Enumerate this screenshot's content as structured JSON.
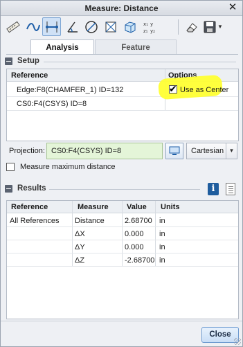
{
  "window": {
    "title": "Measure: Distance",
    "close_icon": "close-icon"
  },
  "toolbar": {
    "buttons": [
      {
        "name": "length-icon",
        "active": false
      },
      {
        "name": "curve-distance-icon",
        "active": false
      },
      {
        "name": "distance-icon",
        "active": true
      },
      {
        "name": "angle-icon",
        "active": false
      },
      {
        "name": "diameter-icon",
        "active": false
      },
      {
        "name": "area-icon",
        "active": false
      },
      {
        "name": "volume-icon",
        "active": false
      },
      {
        "name": "transform-icon",
        "active": false
      },
      {
        "name": "eraser-icon",
        "active": false
      },
      {
        "name": "save-icon",
        "active": false
      }
    ]
  },
  "tabs": {
    "analysis": "Analysis",
    "feature": "Feature"
  },
  "setup": {
    "section_label": "Setup",
    "columns": {
      "reference": "Reference",
      "options": "Options"
    },
    "rows": [
      {
        "reference": "Edge:F8(CHAMFER_1) ID=132",
        "option_label": "Use as Center",
        "option_checked": true
      },
      {
        "reference": "CS0:F4(CSYS) ID=8"
      }
    ],
    "projection_label": "Projection:",
    "projection_value": "CS0:F4(CSYS) ID=8",
    "coord_system": "Cartesian",
    "max_distance_label": "Measure maximum distance",
    "max_distance_checked": false
  },
  "results": {
    "section_label": "Results",
    "columns": {
      "reference": "Reference",
      "measure": "Measure",
      "value": "Value",
      "units": "Units"
    },
    "rows": [
      {
        "reference": "All References",
        "measure": "Distance",
        "value": "2.68700",
        "units": "in"
      },
      {
        "reference": "",
        "measure": "ΔX",
        "value": "0.000",
        "units": "in"
      },
      {
        "reference": "",
        "measure": "ΔY",
        "value": "0.000",
        "units": "in"
      },
      {
        "reference": "",
        "measure": "ΔZ",
        "value": "-2.68700",
        "units": "in"
      }
    ]
  },
  "footer": {
    "close_label": "Close"
  },
  "colors": {
    "highlight": "#ffff33",
    "projection_bg": "#e4f5d8",
    "info_blue": "#1f5d9e"
  }
}
